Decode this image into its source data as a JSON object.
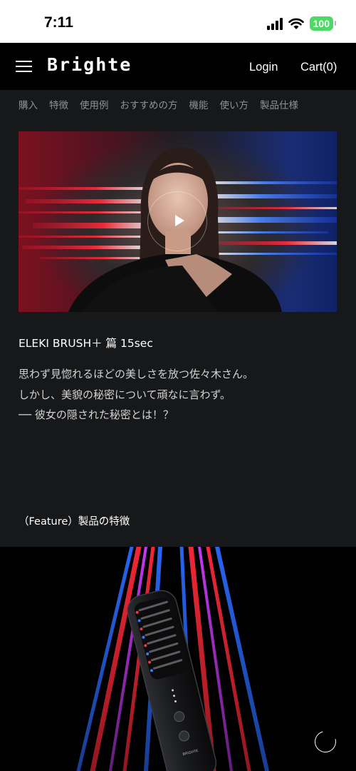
{
  "status_bar": {
    "time": "7:11",
    "battery": "100"
  },
  "header": {
    "logo": "Brighte",
    "login": "Login",
    "cart": "Cart(0)"
  },
  "subnav": [
    "購入",
    "特徴",
    "使用例",
    "おすすめの方",
    "機能",
    "使い方",
    "製品仕様"
  ],
  "video": {
    "title": "ELEKI BRUSH＋ 篇 15sec",
    "description": [
      "思わず見惚れるほどの美しさを放つ佐々木さん。",
      "しかし、美貌の秘密について頑なに言わず。",
      "── 彼女の隠された秘密とは！？"
    ]
  },
  "feature": {
    "heading": "（Feature）製品の特徴"
  },
  "product": {
    "device_label": "BRIGHTE"
  },
  "colors": {
    "accent_red": "#ff2a3a",
    "accent_blue": "#2a6bff",
    "battery_green": "#4cd964",
    "bg_dark": "#17181a"
  }
}
